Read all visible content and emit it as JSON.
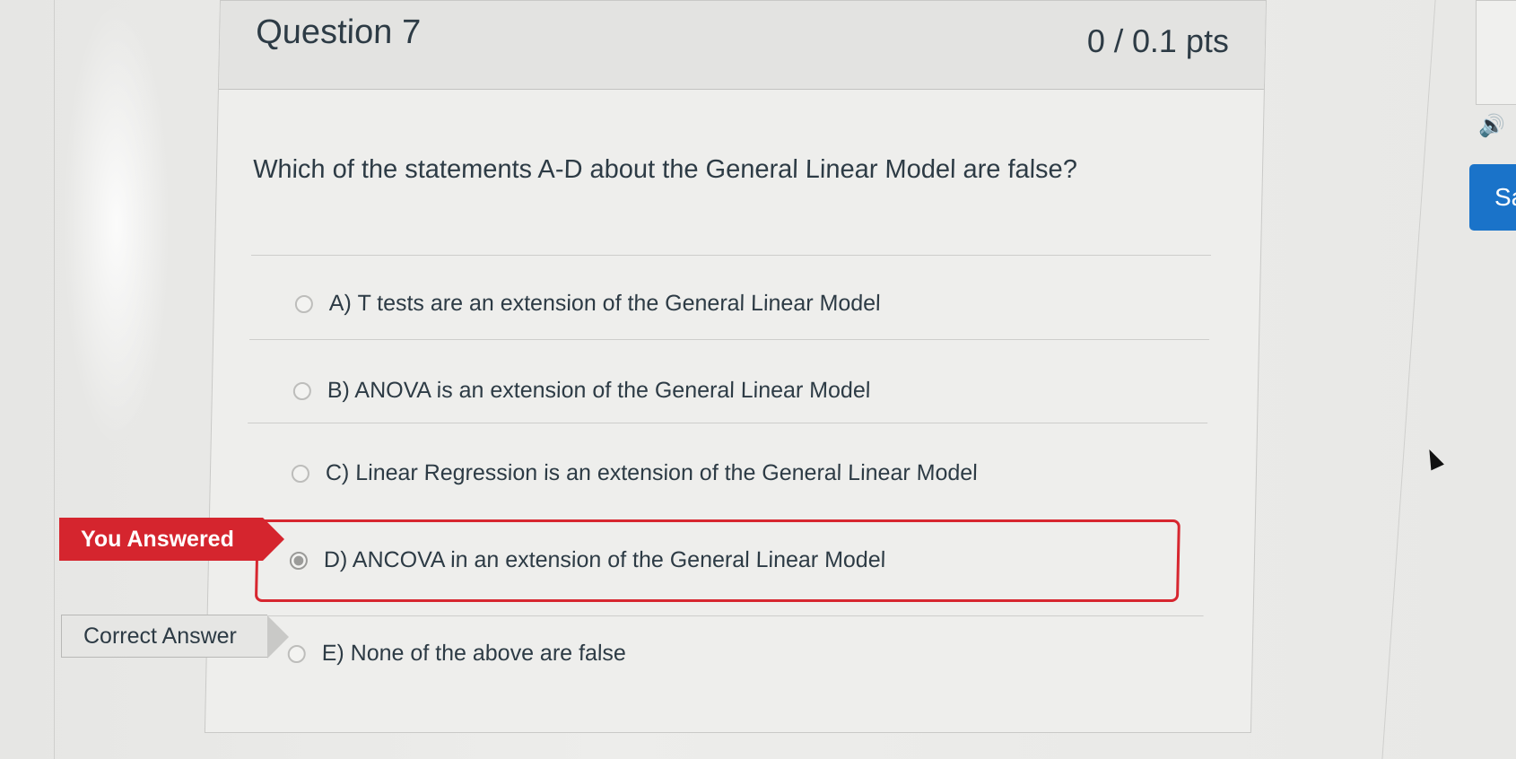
{
  "question": {
    "title": "Question 7",
    "points": "0 / 0.1 pts",
    "text": "Which of the statements A-D about the General Linear Model are false?",
    "answers": [
      {
        "label": "A) T tests are an extension of the General Linear Model",
        "selected": false
      },
      {
        "label": "B) ANOVA is an extension of the General Linear Model",
        "selected": false
      },
      {
        "label": "C) Linear Regression is an extension of the General Linear Model",
        "selected": false
      },
      {
        "label": "D) ANCOVA in an extension of the General Linear Model",
        "selected": true
      },
      {
        "label": "E) None of the above are false",
        "selected": false
      }
    ]
  },
  "tags": {
    "you_answered": "You Answered",
    "correct_answer": "Correct Answer"
  },
  "sidebar": {
    "save_label": "Sa",
    "speaker_icon": "speaker-icon"
  },
  "colors": {
    "wrong": "#d5252e",
    "accent": "#1a73c9"
  }
}
